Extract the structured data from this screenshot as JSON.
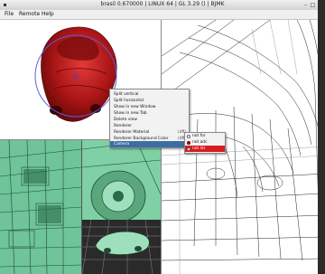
{
  "window": {
    "title": "brasil 0.670000 | LINUX 64 | GL 3.29 () | BJMK",
    "controls": [
      "–",
      "□",
      "×"
    ]
  },
  "menubar": {
    "items": [
      "File",
      "Remote",
      "Help"
    ]
  },
  "context_menu": {
    "items": [
      {
        "label": "Split vertical",
        "shortcut": ""
      },
      {
        "label": "Split horizontal",
        "shortcut": ""
      },
      {
        "label": "Show in new Window",
        "shortcut": ""
      },
      {
        "label": "Show in new Tab",
        "shortcut": ""
      },
      {
        "label": "Delete view",
        "shortcut": ""
      },
      {
        "label": "Renderer",
        "shortcut": ""
      },
      {
        "label": "Renderer Material",
        "shortcut": "(dfl)"
      },
      {
        "label": "Renderer Background Color",
        "shortcut": "(dfl)"
      },
      {
        "label": "Camera",
        "shortcut": ""
      }
    ]
  },
  "submenu": {
    "items": [
      {
        "label": "not for",
        "selected": false
      },
      {
        "label": "not adc",
        "selected": true
      },
      {
        "label": "not ldr",
        "selected": false
      }
    ]
  },
  "icons": {
    "camera_icon": "radio-dot",
    "anchor_icon": "checkbox"
  },
  "colors": {
    "car_body": "#b01818",
    "selection": "#d71c1c",
    "mesh_green": "#6fc49a",
    "menu_highlight": "#3b6ea5"
  }
}
